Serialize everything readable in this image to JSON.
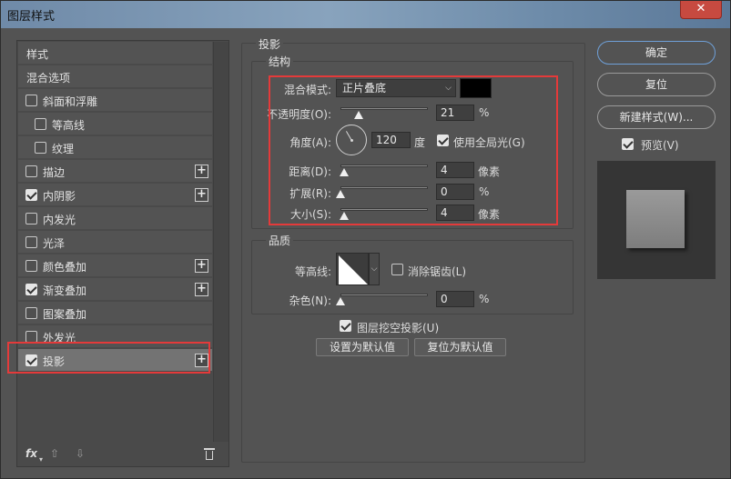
{
  "window": {
    "title": "图层样式",
    "close_icon": "close-icon"
  },
  "left_panel": {
    "items": [
      {
        "label": "样式",
        "has_checkbox": false,
        "checked": false,
        "has_plus": false,
        "indent": 0
      },
      {
        "label": "混合选项",
        "has_checkbox": false,
        "checked": false,
        "has_plus": false,
        "indent": 0
      },
      {
        "label": "斜面和浮雕",
        "has_checkbox": true,
        "checked": false,
        "has_plus": false,
        "indent": 0
      },
      {
        "label": "等高线",
        "has_checkbox": true,
        "checked": false,
        "has_plus": false,
        "indent": 1
      },
      {
        "label": "纹理",
        "has_checkbox": true,
        "checked": false,
        "has_plus": false,
        "indent": 1
      },
      {
        "label": "描边",
        "has_checkbox": true,
        "checked": false,
        "has_plus": true,
        "indent": 0
      },
      {
        "label": "内阴影",
        "has_checkbox": true,
        "checked": true,
        "has_plus": true,
        "indent": 0
      },
      {
        "label": "内发光",
        "has_checkbox": true,
        "checked": false,
        "has_plus": false,
        "indent": 0
      },
      {
        "label": "光泽",
        "has_checkbox": true,
        "checked": false,
        "has_plus": false,
        "indent": 0
      },
      {
        "label": "颜色叠加",
        "has_checkbox": true,
        "checked": false,
        "has_plus": true,
        "indent": 0
      },
      {
        "label": "渐变叠加",
        "has_checkbox": true,
        "checked": true,
        "has_plus": true,
        "indent": 0
      },
      {
        "label": "图案叠加",
        "has_checkbox": true,
        "checked": false,
        "has_plus": false,
        "indent": 0
      },
      {
        "label": "外发光",
        "has_checkbox": true,
        "checked": false,
        "has_plus": false,
        "indent": 0
      },
      {
        "label": "投影",
        "has_checkbox": true,
        "checked": true,
        "has_plus": true,
        "indent": 0,
        "selected": true
      }
    ],
    "footer": {
      "fx_label": "fx",
      "fx_sub": "▾",
      "up_arrow": "⇧",
      "down_arrow": "⇩"
    }
  },
  "drop_shadow": {
    "section_title": "投影",
    "structure": {
      "group_title": "结构",
      "blend_mode_label": "混合模式:",
      "blend_mode_value": "正片叠底",
      "shadow_color": "#000000",
      "opacity_label": "不透明度(O):",
      "opacity_value": "21",
      "opacity_fraction": 0.21,
      "opacity_unit": "%",
      "angle_label": "角度(A):",
      "angle_value": "120",
      "angle_unit": "度",
      "global_light_label": "使用全局光(G)",
      "global_light_checked": true,
      "distance_label": "距离(D):",
      "distance_value": "4",
      "distance_unit": "像素",
      "spread_label": "扩展(R):",
      "spread_value": "0",
      "spread_unit": "%",
      "size_label": "大小(S):",
      "size_value": "4",
      "size_unit": "像素"
    },
    "quality": {
      "group_title": "品质",
      "contour_label": "等高线:",
      "antialias_label": "消除锯齿(L)",
      "antialias_checked": false,
      "noise_label": "杂色(N):",
      "noise_value": "0",
      "noise_unit": "%"
    },
    "knockout_label": "图层挖空投影(U)",
    "knockout_checked": true,
    "set_default_label": "设置为默认值",
    "reset_default_label": "复位为默认值"
  },
  "right_panel": {
    "ok_label": "确定",
    "reset_label": "复位",
    "new_style_label": "新建样式(W)...",
    "preview_label": "预览(V)",
    "preview_checked": true
  },
  "colors": {
    "highlight": "#e43a3a",
    "panel_bg": "#535353",
    "primary_border": "#6fa0d8"
  }
}
